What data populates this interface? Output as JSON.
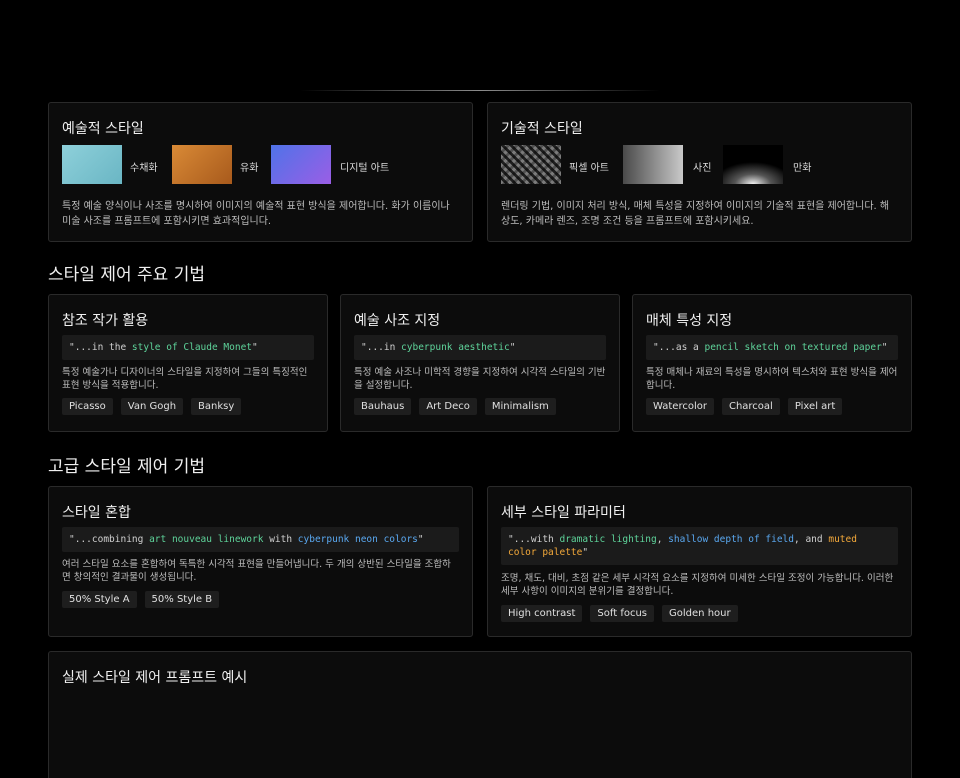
{
  "artistic": {
    "title": "예술적 스타일",
    "swatches": [
      {
        "label": "수채화",
        "color": "#7cc4d0"
      },
      {
        "label": "유화",
        "color": "#c9772a"
      },
      {
        "label": "디지털 아트",
        "color": "#7c6ae8"
      }
    ],
    "desc": "특정 예술 양식이나 사조를 명시하여 이미지의 예술적 표현 방식을 제어합니다. 화가 이름이나 미술 사조를 프롬프트에 포함시키면 효과적입니다."
  },
  "technical": {
    "title": "기술적 스타일",
    "swatches": [
      {
        "label": "픽셀 아트"
      },
      {
        "label": "사진"
      },
      {
        "label": "만화"
      }
    ],
    "desc": "렌더링 기법, 이미지 처리 방식, 매체 특성을 지정하여 이미지의 기술적 표현을 제어합니다. 해상도, 카메라 렌즈, 조명 조건 등을 프롬프트에 포함시키세요."
  },
  "section1": {
    "title": "스타일 제어 주요 기법"
  },
  "techniques": [
    {
      "title": "참조 작가 활용",
      "code_pre": "\"...in the ",
      "code_hl": "style of Claude Monet",
      "code_post": "\"",
      "desc": "특정 예술가나 디자이너의 스타일을 지정하여 그들의 특징적인 표현 방식을 적용합니다.",
      "tags": [
        "Picasso",
        "Van Gogh",
        "Banksy"
      ]
    },
    {
      "title": "예술 사조 지정",
      "code_pre": "\"...in ",
      "code_hl": "cyberpunk aesthetic",
      "code_post": "\"",
      "desc": "특정 예술 사조나 미학적 경향을 지정하여 시각적 스타일의 기반을 설정합니다.",
      "tags": [
        "Bauhaus",
        "Art Deco",
        "Minimalism"
      ]
    },
    {
      "title": "매체 특성 지정",
      "code_pre": "\"...as a ",
      "code_hl": "pencil sketch on textured paper",
      "code_post": "\"",
      "desc": "특정 매체나 재료의 특성을 명시하여 텍스처와 표현 방식을 제어합니다.",
      "tags": [
        "Watercolor",
        "Charcoal",
        "Pixel art"
      ]
    }
  ],
  "section2": {
    "title": "고급 스타일 제어 기법"
  },
  "mixing": {
    "title": "스타일 혼합",
    "code_1": "\"...combining ",
    "code_hl1": "art nouveau linework",
    "code_2": " with ",
    "code_hl2": "cyberpunk neon colors",
    "code_3": "\"",
    "desc": "여러 스타일 요소를 혼합하여 독특한 시각적 표현을 만들어냅니다. 두 개의 상반된 스타일을 조합하면 창의적인 결과물이 생성됩니다.",
    "tags": [
      "50% Style A",
      "50% Style B"
    ]
  },
  "params": {
    "title": "세부 스타일 파라미터",
    "code_1": "\"...with ",
    "code_hl1": "dramatic lighting",
    "code_2": ", ",
    "code_hl2": "shallow depth of field",
    "code_3": ", and ",
    "code_hl3": "muted color palette",
    "code_4": "\"",
    "desc": "조명, 채도, 대비, 초점 같은 세부 시각적 요소를 지정하여 미세한 스타일 조정이 가능합니다. 이러한 세부 사항이 이미지의 분위기를 결정합니다.",
    "tags": [
      "High contrast",
      "Soft focus",
      "Golden hour"
    ]
  },
  "example": {
    "title": "실제 스타일 제어 프롬프트 예시"
  }
}
